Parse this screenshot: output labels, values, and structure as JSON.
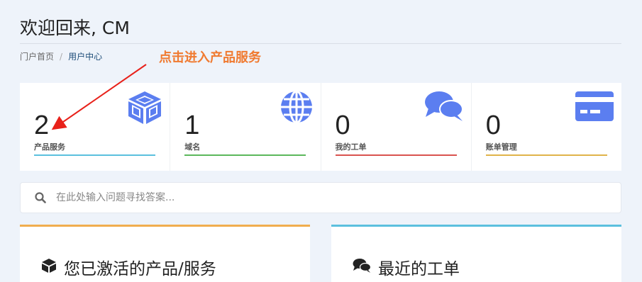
{
  "header": {
    "title": "欢迎回来, CM"
  },
  "breadcrumb": {
    "home": "门户首页",
    "separator": "/",
    "current": "用户中心"
  },
  "annotation": {
    "text": "点击进入产品服务",
    "color": "#f07a30"
  },
  "stats": [
    {
      "value": "2",
      "label": "产品服务",
      "icon": "cube-icon",
      "color": "#5bc0de"
    },
    {
      "value": "1",
      "label": "域名",
      "icon": "globe-icon",
      "color": "#5cb85c"
    },
    {
      "value": "0",
      "label": "我的工单",
      "icon": "comments-icon",
      "color": "#d9534f"
    },
    {
      "value": "0",
      "label": "账单管理",
      "icon": "credit-card-icon",
      "color": "#e0b34a"
    }
  ],
  "icon_color": "#5b7ef0",
  "search": {
    "placeholder": "在此处输入问题寻找答案..."
  },
  "panels": {
    "products": {
      "title": "您已激活的产品/服务",
      "icon": "cube-icon",
      "color": "#f0ad4e"
    },
    "tickets": {
      "title": "最近的工单",
      "icon": "comments-icon",
      "color": "#5bc0de"
    }
  }
}
